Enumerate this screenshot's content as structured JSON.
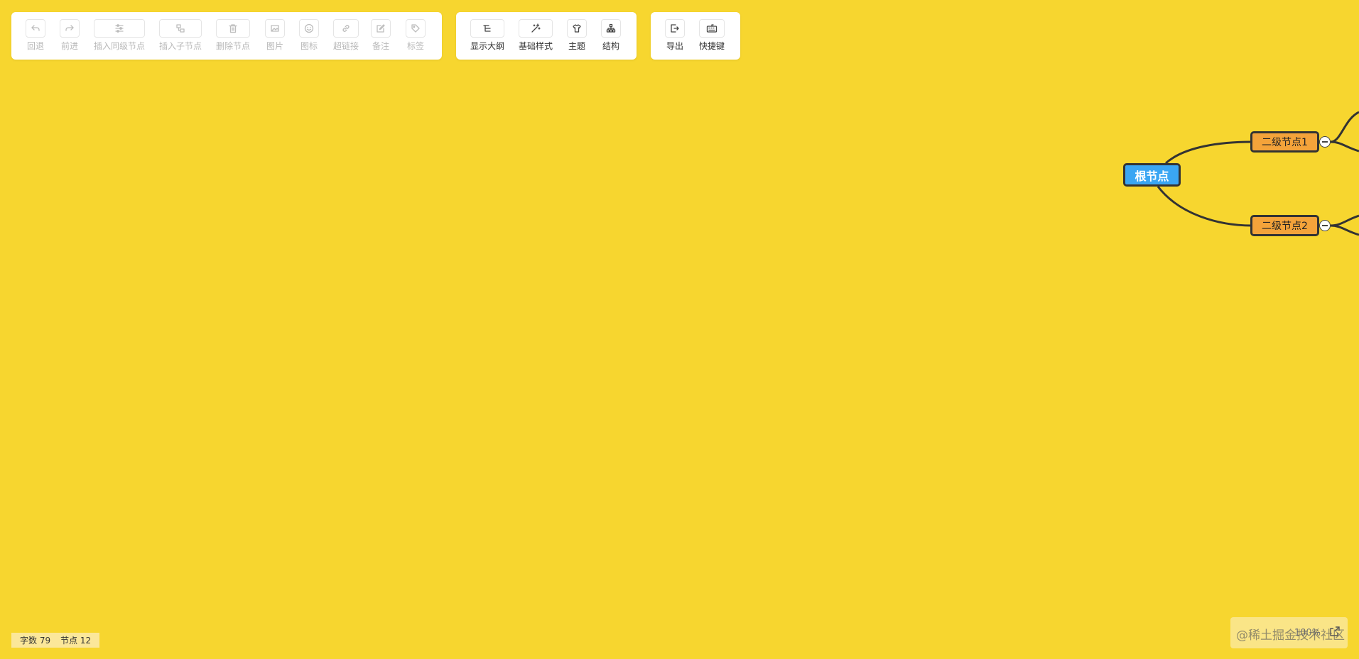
{
  "toolbar": {
    "edit_group": [
      {
        "label": "回退",
        "icon": "undo-icon"
      },
      {
        "label": "前进",
        "icon": "redo-icon"
      },
      {
        "label": "插入同级节点",
        "icon": "sibling-node-icon"
      },
      {
        "label": "插入子节点",
        "icon": "child-node-icon"
      },
      {
        "label": "删除节点",
        "icon": "trash-icon"
      },
      {
        "label": "图片",
        "icon": "image-icon"
      },
      {
        "label": "图标",
        "icon": "smiley-icon"
      },
      {
        "label": "超链接",
        "icon": "link-icon"
      },
      {
        "label": "备注",
        "icon": "note-icon"
      },
      {
        "label": "标签",
        "icon": "tag-icon"
      }
    ],
    "view_group": [
      {
        "label": "显示大纲",
        "icon": "outline-icon"
      },
      {
        "label": "基础样式",
        "icon": "magic-wand-icon"
      },
      {
        "label": "主题",
        "icon": "shirt-icon"
      },
      {
        "label": "结构",
        "icon": "structure-icon"
      }
    ],
    "export_group": [
      {
        "label": "导出",
        "icon": "export-icon"
      },
      {
        "label": "快捷键",
        "icon": "keyboard-icon"
      }
    ]
  },
  "mindmap": {
    "root": "根节点",
    "children": [
      "二级节点1",
      "二级节点2"
    ]
  },
  "status": {
    "word_count_label": "字数 79",
    "node_count_label": "节点 12"
  },
  "zoom": {
    "value": "100%"
  },
  "watermark": "@稀土掘金技术社区",
  "colors": {
    "canvas_background": "#f7d62f",
    "root_node": "#3aa6f3",
    "sub_node": "#f4a33a",
    "line": "#333333"
  }
}
